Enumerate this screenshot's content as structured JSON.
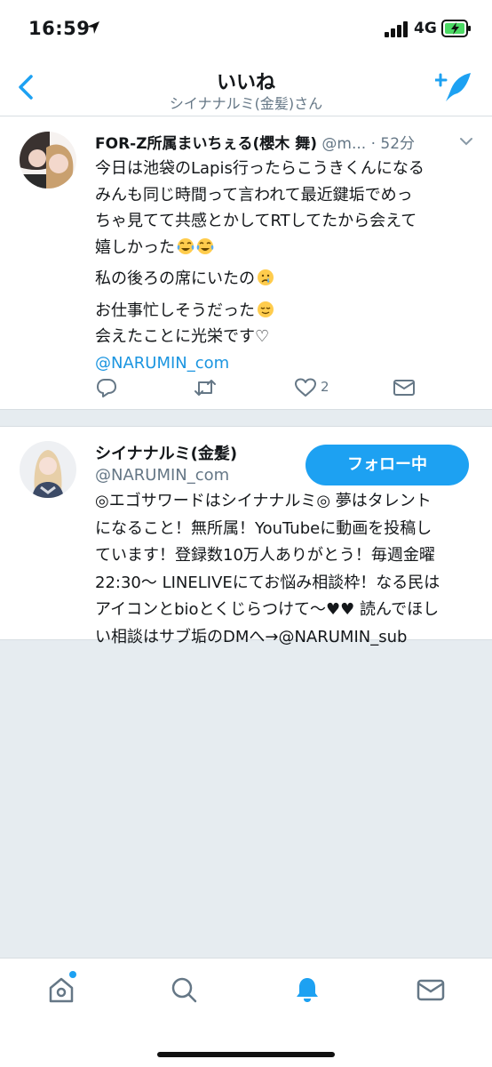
{
  "status_bar": {
    "time": "16:59",
    "network": "4G"
  },
  "header": {
    "title": "いいね",
    "subtitle": "シイナナルミ(金髪)さん"
  },
  "tweet": {
    "author_name": "FOR-Z所属まいちぇる(櫻木 舞)",
    "author_handle": "@m...",
    "time": "· 52分",
    "lines": [
      "今日は池袋のLapis行ったらこうきくんになる",
      "みんも同じ時間って言われて最近鍵垢でめっ",
      "ちゃ見てて共感とかしてRTしてたから会えて",
      "嬉しかった",
      "私の後ろの席にいたの",
      "お仕事忙しそうだった",
      "会えたことに光栄です♡"
    ],
    "emojis": [
      "face-with-tears-of-joy",
      "face-with-tears-of-joy",
      "crying-face",
      "relieved-face"
    ],
    "mention": "@NARUMIN_com",
    "like_count": "2"
  },
  "user": {
    "name": "シイナナルミ(金髪)",
    "handle": "@NARUMIN_com",
    "follow_label": "フォロー中",
    "bio_lines": [
      "◎エゴサワードはシイナナルミ◎ 夢はタレント",
      "になること！無所属！YouTubeに動画を投稿し",
      "ています！登録数10万人ありがとう！毎週金曜",
      "22:30〜 LINELIVEにてお悩み相談枠！なる民は",
      "アイコンとbioとくじらつけて〜♥♥ 読んでほし",
      "い相談はサブ垢のDMへ→@NARUMIN_sub"
    ]
  },
  "tabs": [
    "home-icon",
    "search-icon",
    "notifications-icon",
    "messages-icon"
  ],
  "colors": {
    "accent": "#1da1f2",
    "link": "#1b95e0",
    "muted": "#657786",
    "background": "#e6ecf0"
  }
}
